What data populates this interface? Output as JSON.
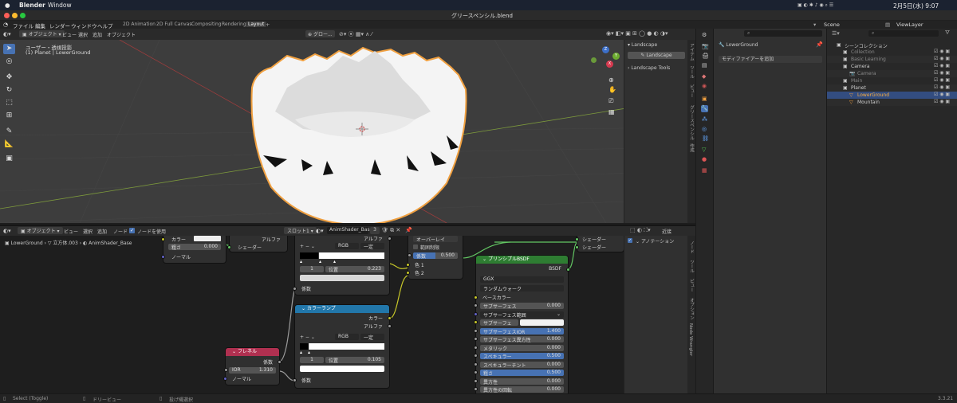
{
  "macbar": {
    "apple": "",
    "app": "Blender",
    "window": "Window",
    "status": "2月5日(水) 9:07"
  },
  "titlebar": {
    "title": "グリースペンシル.blend"
  },
  "menubar": {
    "items": [
      "ファイル",
      "編集",
      "レンダー",
      "ウィンドウ",
      "ヘルプ"
    ],
    "workspaces": [
      "2D Animation",
      "2D Full Canvas",
      "Compositing",
      "Rendering",
      "Layout"
    ],
    "active_workspace": "Layout",
    "scene": "Scene",
    "view_layer": "ViewLayer"
  },
  "viewport": {
    "mode": "オブジェクト",
    "menus": [
      "ビュー",
      "選択",
      "追加",
      "オブジェクト"
    ],
    "orientation": "グロー...",
    "info_line1": "ユーザー・透視投影",
    "info_line2": "(1) Planet | LowerGround",
    "axes": {
      "x": "X",
      "y": "Y",
      "z": "Z"
    }
  },
  "npanel": {
    "section": "Landscape",
    "button": "Landscape",
    "tools": "Landscape Tools",
    "tabs": [
      "アイテム",
      "ツール",
      "ビュー",
      "グリースペンシル",
      "作成"
    ]
  },
  "properties": {
    "object": "LowerGround",
    "modifier_btn": "モディファイアーを追加"
  },
  "outliner": {
    "title": "シーンコレクション",
    "rows": [
      {
        "label": "Collection",
        "indent": 1
      },
      {
        "label": "Basic Learning",
        "indent": 1
      },
      {
        "label": "Camera",
        "indent": 1
      },
      {
        "label": "Camera",
        "indent": 2
      },
      {
        "label": "Main",
        "indent": 1
      },
      {
        "label": "Planet",
        "indent": 1
      },
      {
        "label": "LowerGround",
        "indent": 2
      },
      {
        "label": "Mountain",
        "indent": 2
      }
    ]
  },
  "node_editor": {
    "mode": "オブジェクト",
    "menus": [
      "ビュー",
      "選択",
      "追加",
      "ノード"
    ],
    "use_nodes": "ノードを使用",
    "slot": "スロット1",
    "material": "AnimShader_Base",
    "users": "3",
    "breadcrumb": [
      "LowerGround",
      "立方体.003",
      "AnimShader_Base"
    ],
    "side_header": "アノテーション",
    "side_tabs": [
      "ノード",
      "ツール",
      "ビュー",
      "オプション",
      "Node Wrangler"
    ]
  },
  "nodes": {
    "top_left": {
      "color_label": "カラー",
      "roughness_label": "粗さ",
      "roughness": "0.000",
      "normal_label": "ノーマル"
    },
    "shader_stub": {
      "alpha_label": "アルファ",
      "shader_label": "シェーダー"
    },
    "ramp1": {
      "alpha_label": "アルファ",
      "mode": "RGB",
      "interp": "一定",
      "index": "1",
      "pos_label": "位置",
      "pos": "0.223",
      "fac_label": "係数"
    },
    "mix": {
      "blend": "オーバーレイ",
      "clamp": "範囲制限",
      "fac_label": "係数",
      "fac": "0.500",
      "color1": "色 1",
      "color2": "色 2"
    },
    "output": {
      "shader1": "シェーダー",
      "shader2": "シェーダー"
    },
    "ramp2": {
      "title": "カラーランプ",
      "color_label": "カラー",
      "alpha_label": "アルファ",
      "mode": "RGB",
      "interp": "一定",
      "index": "1",
      "pos_label": "位置",
      "pos": "0.105",
      "fac_label": "係数"
    },
    "fresnel": {
      "title": "フレネル",
      "fac_label": "係数",
      "ior_label": "IOR",
      "ior": "1.310",
      "normal_label": "ノーマル"
    },
    "bsdf": {
      "title": "プリンシプルBSDF",
      "out": "BSDF",
      "dist": "GGX",
      "sss": "ランダムウォーク",
      "base_color": "ベースカラー",
      "rows": [
        {
          "l": "サブサーフェス",
          "v": "0.000",
          "blue": false
        },
        {
          "l": "サブサーフェス範囲",
          "v": "",
          "blue": false
        },
        {
          "l": "サブサーフェス...",
          "v": "",
          "blue": false
        },
        {
          "l": "サブサーフェスIOR",
          "v": "1.400",
          "blue": true
        },
        {
          "l": "サブサーフェス異方性",
          "v": "0.000",
          "blue": false
        },
        {
          "l": "メタリック",
          "v": "0.000",
          "blue": false
        },
        {
          "l": "スペキュラー",
          "v": "0.500",
          "blue": true
        },
        {
          "l": "スペキュラーチント",
          "v": "0.000",
          "blue": false
        },
        {
          "l": "粗さ",
          "v": "0.500",
          "blue": true
        },
        {
          "l": "異方性",
          "v": "0.000",
          "blue": false
        },
        {
          "l": "異方性の回転",
          "v": "0.000",
          "blue": false
        }
      ]
    }
  },
  "statusbar": {
    "select": "Select (Toggle)",
    "dolly": "ドリービュー",
    "lasso": "投げ縄選択",
    "version": "3.3.21"
  },
  "colors": {
    "accent": "#4772b3",
    "selection_orange": "#f0a040",
    "principled_header": "#2e7d32",
    "ramp_header": "#2277aa",
    "fresnel_header": "#b03050"
  }
}
